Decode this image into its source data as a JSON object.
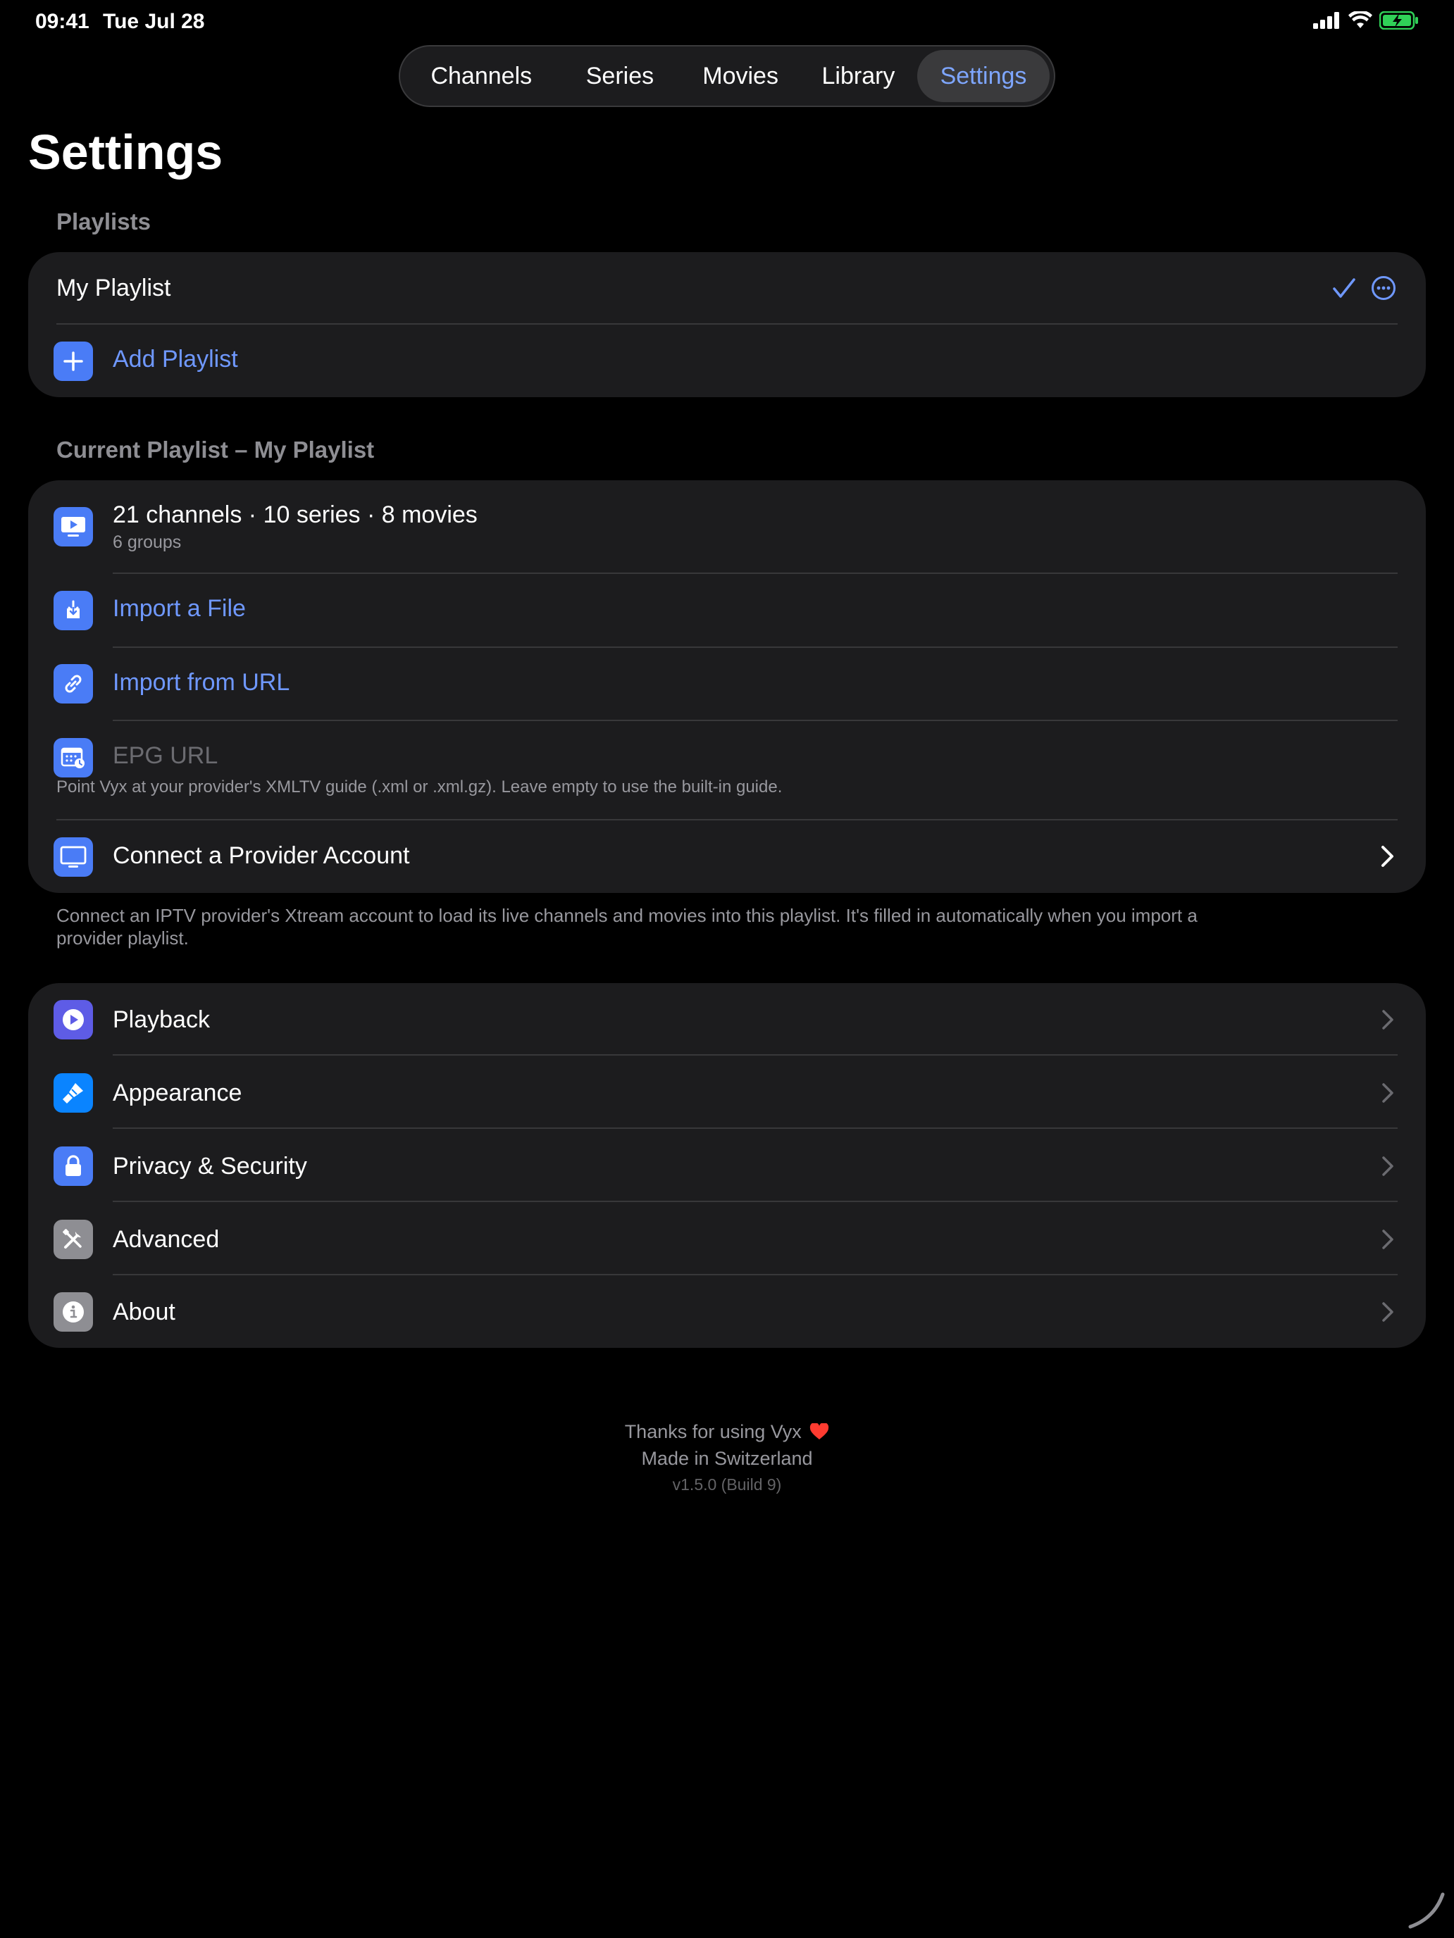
{
  "status_bar": {
    "time": "09:41",
    "date": "Tue Jul 28"
  },
  "tabs": [
    {
      "label": "Channels",
      "active": false
    },
    {
      "label": "Series",
      "active": false
    },
    {
      "label": "Movies",
      "active": false
    },
    {
      "label": "Library",
      "active": false
    },
    {
      "label": "Settings",
      "active": true
    }
  ],
  "page_title": "Settings",
  "playlists": {
    "header": "Playlists",
    "items": [
      {
        "label": "My Playlist",
        "selected": true
      }
    ],
    "add_label": "Add Playlist"
  },
  "current_playlist": {
    "header": "Current Playlist – My Playlist",
    "summary": "21 channels · 10 series · 8 movies",
    "groups": "6 groups",
    "import_file": "Import a File",
    "import_url": "Import from URL",
    "epg_placeholder": "EPG URL",
    "epg_hint": "Point Vyx at your provider's XMLTV guide (.xml or .xml.gz). Leave empty to use the built-in guide.",
    "provider": "Connect a Provider Account",
    "footnote_line1": "Connect an IPTV provider's Xtream account to load its live channels and movies into this playlist. It's filled in automatically when you import a",
    "footnote_line2": "provider playlist."
  },
  "settings_menu": [
    {
      "label": "Playback",
      "icon": "play-icon",
      "color": "#5e5ce6"
    },
    {
      "label": "Appearance",
      "icon": "paintbrush-icon",
      "color": "#0a84ff"
    },
    {
      "label": "Privacy & Security",
      "icon": "lock-icon",
      "color": "#4a7cf6"
    },
    {
      "label": "Advanced",
      "icon": "tools-icon",
      "color": "#8e8e93"
    },
    {
      "label": "About",
      "icon": "info-icon",
      "color": "#8e8e93"
    }
  ],
  "footer": {
    "thanks": "Thanks for using Vyx",
    "made_in": "Made in Switzerland",
    "version": "v1.5.0 (Build 9)"
  },
  "colors": {
    "accent": "#6f98ff",
    "card": "#1c1c1e",
    "separator": "#38383a",
    "battery": "#30d158",
    "heart": "#ff3b30"
  }
}
